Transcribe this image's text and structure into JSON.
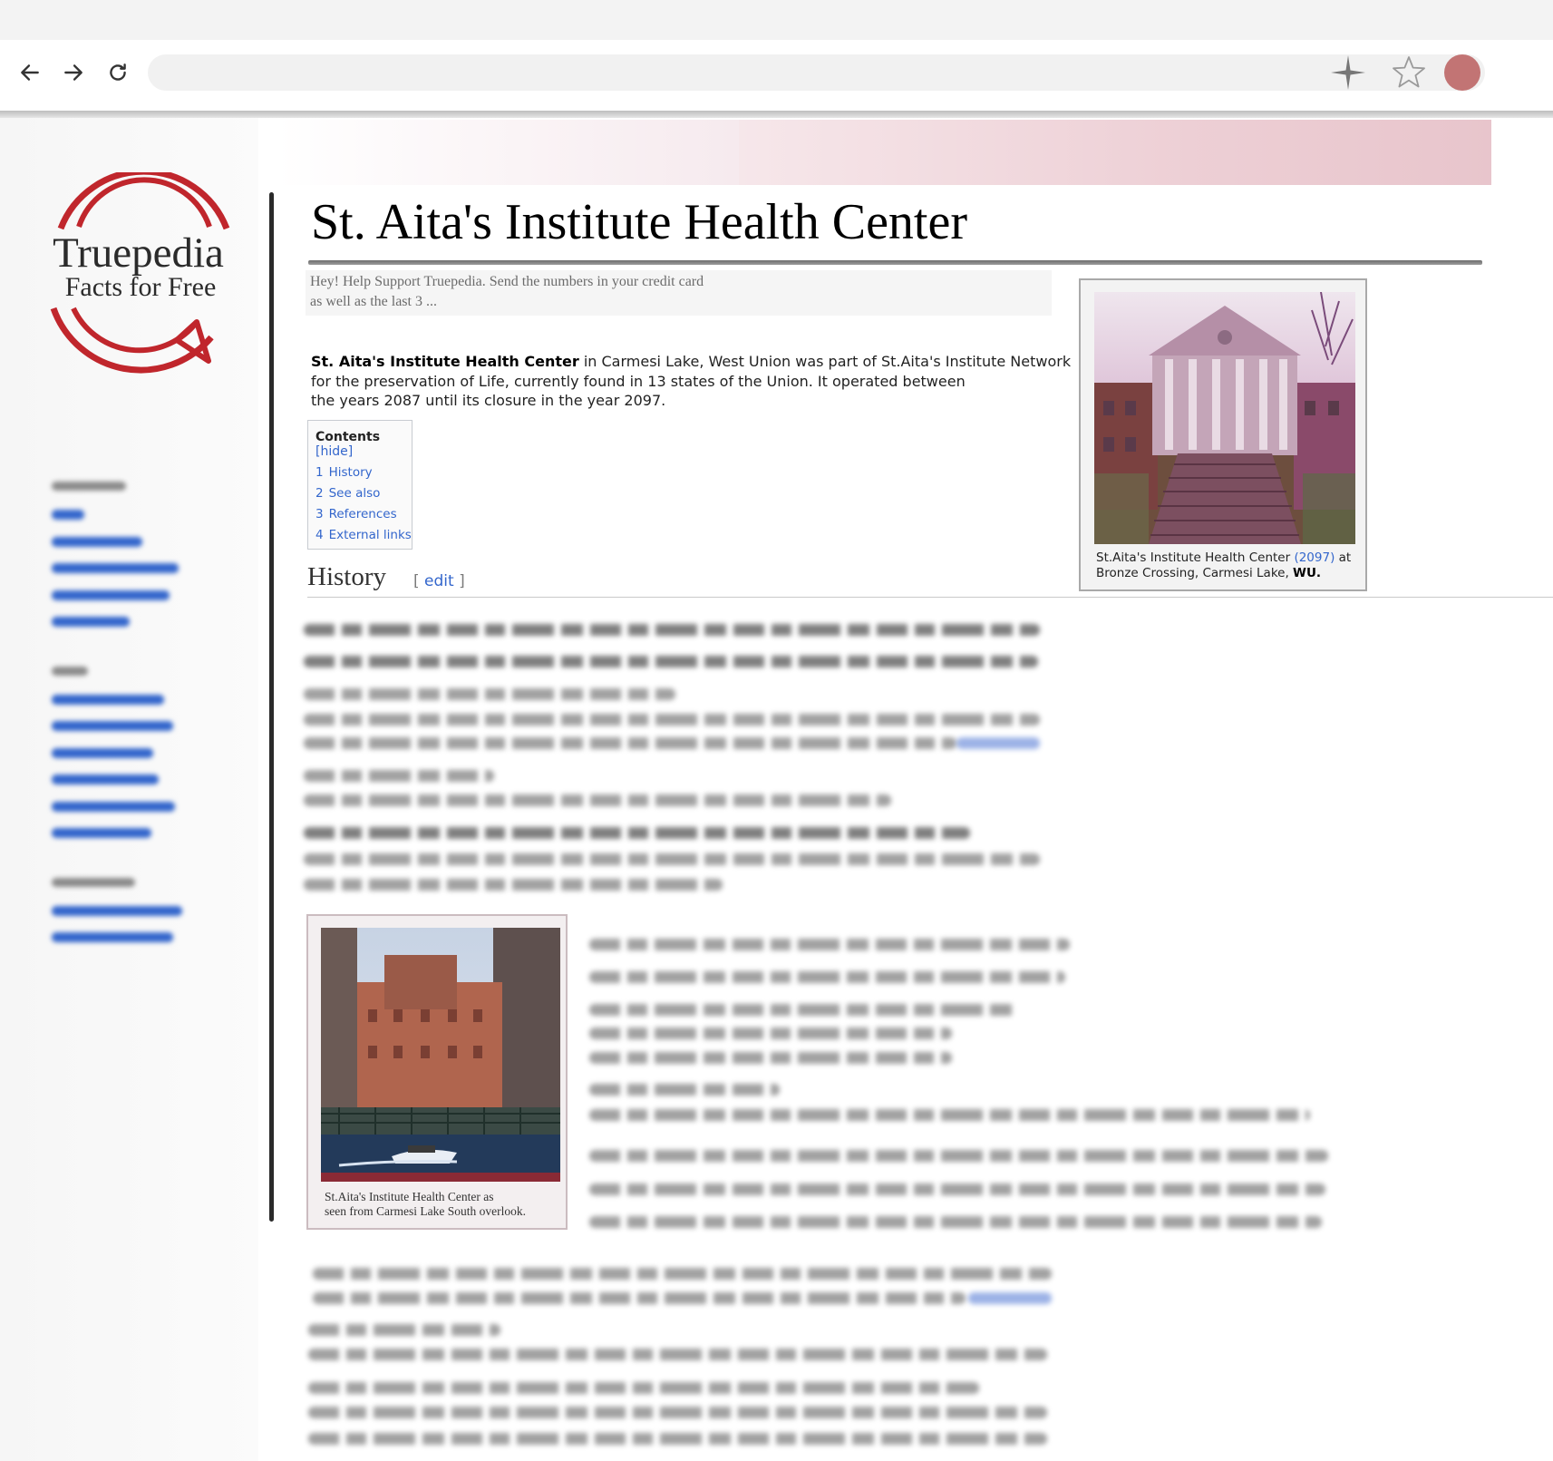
{
  "browser": {
    "back_icon": "arrow-left-icon",
    "forward_icon": "arrow-right-icon",
    "reload_icon": "reload-icon",
    "address_value": "",
    "sparkle_icon": "sparkle-icon",
    "bookmark_icon": "star-outline-icon",
    "profile_color": "#c27474"
  },
  "logo": {
    "title": "Truepedia",
    "tagline": "Facts for Free",
    "accent_color": "#c0262c"
  },
  "article": {
    "title": "St. Aita's Institute Health Center",
    "notice": {
      "line1": "Hey! Help Support Truepedia. Send the numbers in your credit card",
      "line2": "as well as the last 3 ..."
    },
    "intro": {
      "subject": "St. Aita's Institute Health Center",
      "line1_rest": " in Carmesi Lake, West Union was part of St.Aita's Institute Network",
      "line2": "for the preservation of Life, currently found in 13 states of the Union. It operated between",
      "line3": "the years 2087 until its closure in the year 2097."
    },
    "toc": {
      "title": "Contents",
      "hide_label": "[hide]",
      "items": [
        {
          "num": "1",
          "label": "History"
        },
        {
          "num": "2",
          "label": "See also"
        },
        {
          "num": "3",
          "label": "References"
        },
        {
          "num": "4",
          "label": "External links"
        }
      ]
    },
    "history": {
      "heading": "History",
      "edit_open": "[",
      "edit_label": "edit",
      "edit_close": "]"
    },
    "infobox": {
      "caption_part1": "St.Aita's Institute Health Center ",
      "caption_year": "(2097)",
      "caption_part2": " at",
      "caption_line2_plain": "Bronze Crossing, Carmesi Lake, ",
      "caption_line2_bold": "WU."
    },
    "figure2": {
      "caption_line1": "St.Aita's Institute Health Center as",
      "caption_line2": "seen from Carmesi Lake South overlook."
    }
  }
}
